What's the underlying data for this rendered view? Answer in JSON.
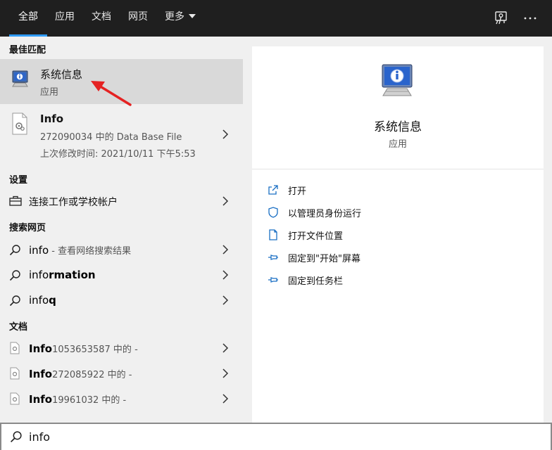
{
  "tabs": [
    {
      "label": "全部",
      "active": true
    },
    {
      "label": "应用"
    },
    {
      "label": "文档"
    },
    {
      "label": "网页"
    },
    {
      "label": "更多"
    }
  ],
  "top_icons": [
    "feedback-icon",
    "more-options-icon"
  ],
  "sections": {
    "best_match": "最佳匹配",
    "settings": "设置",
    "web": "搜索网页",
    "documents": "文档"
  },
  "best_match": {
    "title": "系统信息",
    "subtitle": "应用",
    "icon": "system-info-icon"
  },
  "info_file": {
    "title": "Info",
    "line1": "272090034 中的 Data Base File",
    "line2": "上次修改时间: 2021/10/11 下午5:53",
    "icon": "file-gear-icon"
  },
  "settings_item": {
    "label": "连接工作或学校帐户",
    "icon": "briefcase-icon"
  },
  "web_items": [
    {
      "prefix": "info",
      "rest": "",
      "hint": " - 查看网络搜索结果"
    },
    {
      "prefix": "info",
      "rest": "rmation",
      "hint": ""
    },
    {
      "prefix": "info",
      "rest": "q",
      "hint": ""
    }
  ],
  "doc_items": [
    {
      "bold": "Info",
      "rest": "1053653587 中的 -"
    },
    {
      "bold": "Info",
      "rest": "272085922 中的 -"
    },
    {
      "bold": "Info",
      "rest": "19961032 中的 -"
    }
  ],
  "detail": {
    "title": "系统信息",
    "subtitle": "应用",
    "actions": [
      {
        "label": "打开",
        "icon": "open-icon"
      },
      {
        "label": "以管理员身份运行",
        "icon": "shield-icon"
      },
      {
        "label": "打开文件位置",
        "icon": "file-location-icon"
      },
      {
        "label": "固定到\"开始\"屏幕",
        "icon": "pin-icon"
      },
      {
        "label": "固定到任务栏",
        "icon": "pin-icon"
      }
    ]
  },
  "search": {
    "value": "info"
  },
  "colors": {
    "accent": "#2f9bf7",
    "topbar": "#1f1f1f",
    "selected": "#d9d9d9",
    "arrow": "#e52222"
  }
}
